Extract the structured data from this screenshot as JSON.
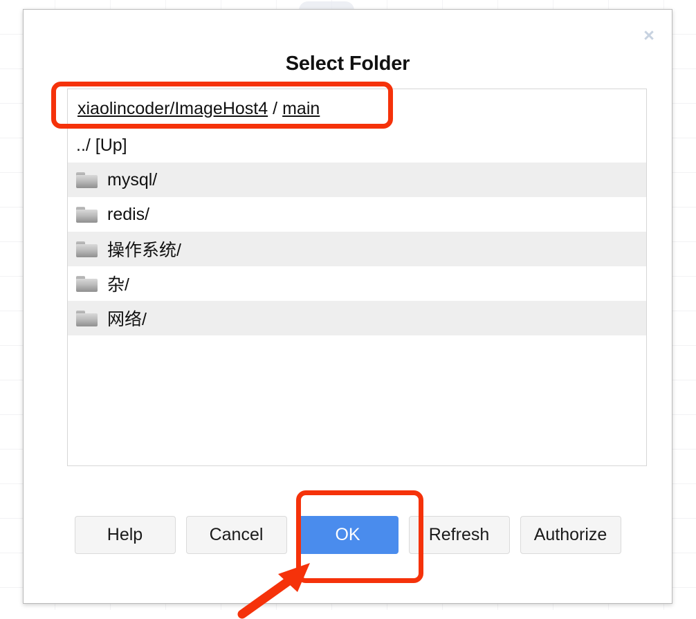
{
  "dialog": {
    "title": "Select Folder",
    "close_label": "×",
    "close_icon": "close-icon"
  },
  "breadcrumb": {
    "repo": "xiaolincoder/ImageHost4",
    "separator": "/",
    "branch": "main"
  },
  "folder_list": [
    {
      "label": "../ [Up]",
      "icon": null,
      "striped": false
    },
    {
      "label": "mysql/",
      "icon": "folder-icon",
      "striped": true
    },
    {
      "label": "redis/",
      "icon": "folder-icon",
      "striped": false
    },
    {
      "label": "操作系统/",
      "icon": "folder-icon",
      "striped": true
    },
    {
      "label": "杂/",
      "icon": "folder-icon",
      "striped": false
    },
    {
      "label": "网络/",
      "icon": "folder-icon",
      "striped": true
    }
  ],
  "buttons": [
    {
      "label": "Help",
      "primary": false,
      "name": "help-button"
    },
    {
      "label": "Cancel",
      "primary": false,
      "name": "cancel-button"
    },
    {
      "label": "OK",
      "primary": true,
      "name": "ok-button"
    },
    {
      "label": "Refresh",
      "primary": false,
      "name": "refresh-button"
    },
    {
      "label": "Authorize",
      "primary": false,
      "name": "authorize-button"
    }
  ],
  "colors": {
    "primary_button": "#4a8ced",
    "annotation": "#f5320a",
    "row_stripe": "#eeeeee",
    "close_icon": "#c7d2e0"
  }
}
